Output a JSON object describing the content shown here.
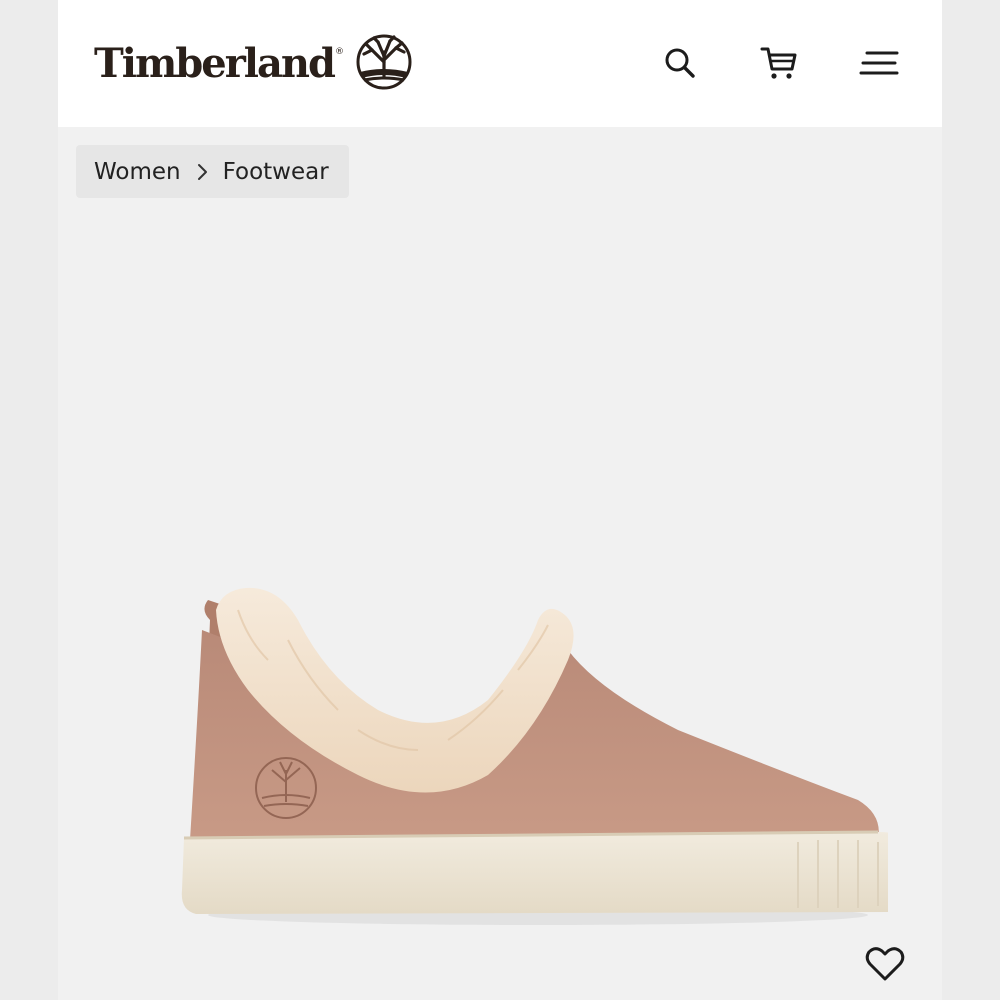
{
  "header": {
    "brand_name": "Timberland",
    "brand_mark": "®",
    "icons": {
      "search": "search-icon",
      "cart": "cart-icon",
      "menu": "menu-icon"
    }
  },
  "breadcrumb": {
    "items": [
      "Women",
      "Footwear"
    ],
    "separator_icon": "chevron-right-icon"
  },
  "product": {
    "image": "shoe-image",
    "favorite_icon": "heart-icon"
  },
  "colors": {
    "brand_dark": "#2a201a",
    "suede": "#c0917e",
    "fur": "#f3e3cc",
    "sole": "#ece4d3",
    "page_bg": "#f1f1f1"
  }
}
